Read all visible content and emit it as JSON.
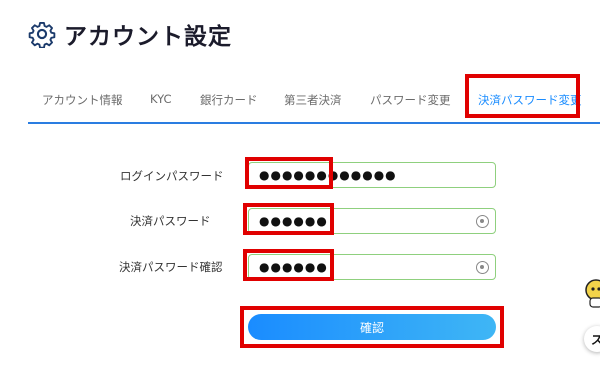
{
  "page": {
    "title": "アカウント設定"
  },
  "tabs": [
    {
      "label": "アカウント情報"
    },
    {
      "label": "KYC"
    },
    {
      "label": "銀行カード"
    },
    {
      "label": "第三者決済"
    },
    {
      "label": "パスワード変更"
    },
    {
      "label": "決済パスワード変更",
      "active": true
    }
  ],
  "form": {
    "login_password": {
      "label": "ログインパスワード",
      "value": "●●●●●●●●●●●●"
    },
    "payment_password": {
      "label": "決済パスワード",
      "value": "●●●●●●"
    },
    "payment_password_confirm": {
      "label": "決済パスワード確認",
      "value": "●●●●●●"
    },
    "submit_label": "確認"
  },
  "side": {
    "bubble_text": "ス"
  },
  "colors": {
    "accent": "#1a8cff",
    "highlight": "#e00000",
    "field_border": "#8fd07e"
  }
}
